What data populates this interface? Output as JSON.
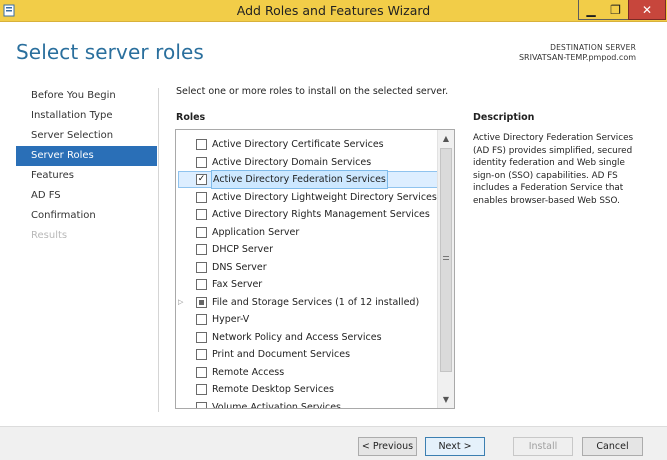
{
  "window": {
    "title": "Add Roles and Features Wizard",
    "controls": {
      "minimize": "▁",
      "maximize": "❐",
      "close": "✕"
    }
  },
  "header": {
    "title": "Select server roles",
    "destination_label": "DESTINATION SERVER",
    "destination_value": "SRIVATSAN-TEMP.pmpod.com"
  },
  "nav": {
    "items": [
      {
        "label": "Before You Begin",
        "state": "normal"
      },
      {
        "label": "Installation Type",
        "state": "normal"
      },
      {
        "label": "Server Selection",
        "state": "normal"
      },
      {
        "label": "Server Roles",
        "state": "active"
      },
      {
        "label": "Features",
        "state": "normal"
      },
      {
        "label": "AD FS",
        "state": "normal"
      },
      {
        "label": "Confirmation",
        "state": "normal"
      },
      {
        "label": "Results",
        "state": "disabled"
      }
    ]
  },
  "main": {
    "instruction": "Select one or more roles to install on the selected server.",
    "roles_label": "Roles",
    "roles": [
      {
        "label": "Active Directory Certificate Services",
        "checked": false
      },
      {
        "label": "Active Directory Domain Services",
        "checked": false
      },
      {
        "label": "Active Directory Federation Services",
        "checked": true,
        "selected": true
      },
      {
        "label": "Active Directory Lightweight Directory Services",
        "checked": false
      },
      {
        "label": "Active Directory Rights Management Services",
        "checked": false
      },
      {
        "label": "Application Server",
        "checked": false
      },
      {
        "label": "DHCP Server",
        "checked": false
      },
      {
        "label": "DNS Server",
        "checked": false
      },
      {
        "label": "Fax Server",
        "checked": false
      },
      {
        "label": "File and Storage Services (1 of 12 installed)",
        "checked": "partial",
        "expandable": true
      },
      {
        "label": "Hyper-V",
        "checked": false
      },
      {
        "label": "Network Policy and Access Services",
        "checked": false
      },
      {
        "label": "Print and Document Services",
        "checked": false
      },
      {
        "label": "Remote Access",
        "checked": false
      },
      {
        "label": "Remote Desktop Services",
        "checked": false
      },
      {
        "label": "Volume Activation Services",
        "checked": false
      }
    ],
    "scrollbar": {
      "up": "▲",
      "down": "▼"
    },
    "description_label": "Description",
    "description_text": "Active Directory Federation Services (AD FS) provides simplified, secured identity federation and Web single sign-on (SSO) capabilities. AD FS includes a Federation Service that enables browser-based Web SSO."
  },
  "footer": {
    "previous": "< Previous",
    "next": "Next >",
    "install": "Install",
    "cancel": "Cancel"
  }
}
